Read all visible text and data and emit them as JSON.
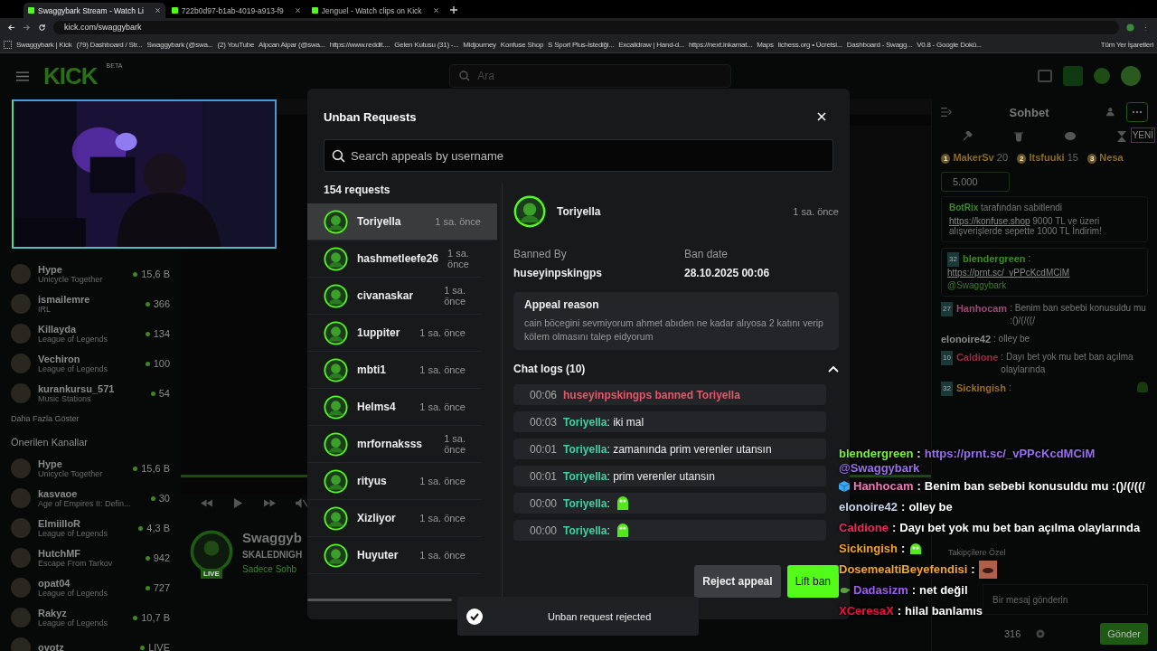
{
  "browser": {
    "tabs": [
      {
        "title": "Swaggybark Stream - Watch Li",
        "selected": true
      },
      {
        "title": "722b0d97-b1ab-4019-a913-f9",
        "selected": false
      },
      {
        "title": "Jenguel - Watch clips on Kick",
        "selected": false
      }
    ],
    "url": "kick.com/swaggybark",
    "bookmarks": [
      "Swaggybark | Kick",
      "(79) Dashboard / Str...",
      "Swaggybark (@swa...",
      "(2) YouTube",
      "Alpcan Alpar (@swa...",
      "https://www.reddit....",
      "Gelen Kutusu (31) -...",
      "Midjourney",
      "Konfuse Shop",
      "S Sport Plus-İstediği...",
      "Excalidraw | Hand-d...",
      "https://next.inkamat...",
      "Maps",
      "lichess.org • Ücretsi...",
      "Dashboard - Swagg...",
      "V0.8 - Google Dokü..."
    ],
    "all_bookmarks": "Tüm Yer İşaretleri"
  },
  "header": {
    "logo": "KICK",
    "logo_badge": "BETA",
    "search_placeholder": "Ara"
  },
  "sidebar": {
    "followed": [
      {
        "name": "Hype",
        "category": "Unicycle Together",
        "viewers": "15,6 B"
      },
      {
        "name": "ismailemre",
        "category": "IRL",
        "viewers": "366"
      },
      {
        "name": "Killayda",
        "category": "League of Legends",
        "viewers": "134"
      },
      {
        "name": "Vechiron",
        "category": "League of Legends",
        "viewers": "100"
      },
      {
        "name": "kurankursu_571",
        "category": "Music Stations",
        "viewers": "54"
      }
    ],
    "show_more": "Daha Fazla Göster",
    "recommended_heading": "Önerilen Kanallar",
    "recommended": [
      {
        "name": "Hype",
        "category": "Unicycle Together",
        "viewers": "15,6 B"
      },
      {
        "name": "kasvaoe",
        "category": "Age of Empires II: Defin...",
        "viewers": "30"
      },
      {
        "name": "ElmiilloR",
        "category": "League of Legends",
        "viewers": "4,3 B"
      },
      {
        "name": "HutchMF",
        "category": "Escape From Tarkov",
        "viewers": "942"
      },
      {
        "name": "opat04",
        "category": "League of Legends",
        "viewers": "727"
      },
      {
        "name": "Rakyz",
        "category": "League of Legends",
        "viewers": "10,7 B"
      },
      {
        "name": "ovotz",
        "viewers": "LIVE"
      }
    ]
  },
  "stream": {
    "live": "LIVE",
    "channel": "Swaggyb",
    "title": "SKALEDNIGH",
    "category": "Sadece Sohb"
  },
  "chat": {
    "title": "Sohbet",
    "new_badge": "YENİ",
    "leaderboard": [
      {
        "rank": "1",
        "name": "MakerSv",
        "score": "20"
      },
      {
        "rank": "2",
        "name": "Itsfuuki",
        "score": "15"
      },
      {
        "rank": "3",
        "name": "Nesa"
      }
    ],
    "gift": "5.000",
    "pinned": {
      "by": "BotRix",
      "note": "tarafından sabitlendi",
      "link": "https://konfuse.shop",
      "text": " 9000 TL ve üzeri alışverişlerde sepette 1000 TL İndirim!"
    },
    "messages": [
      {
        "badge": "32",
        "user": "blendergreen",
        "color": "#3a8a22",
        "text": ":",
        "link": "https://prnt.sc/_vPPcKcdMCiM",
        "mention": "@Swaggybark"
      },
      {
        "badge": "27",
        "user": "Hanhocam",
        "color": "#9a4a72",
        "text": ": Benim ban sebebi konusuldu mu :()/(/((/"
      },
      {
        "user": "elonoire42",
        "color": "#8a8a8a",
        "text": ": olley be"
      },
      {
        "badge": "10",
        "user": "Caldione",
        "color": "#9a2c40",
        "text": ": Dayı bet yok mu bet ban açılma olaylarında"
      },
      {
        "badge": "32",
        "user": "Sickingish",
        "color": "#9a6c20",
        "text": ":",
        "emote": true
      }
    ],
    "followers_only": "Takipçilere Özel",
    "input_placeholder": "Bir mesaj gönderin",
    "points": "316",
    "send": "Gönder"
  },
  "modal": {
    "title": "Unban Requests",
    "search_placeholder": "Search appeals by username",
    "count": "154 requests",
    "requests": [
      {
        "name": "Toriyella",
        "time": "1 sa. önce",
        "selected": true
      },
      {
        "name": "hashmetleefe26",
        "time": "1 sa. önce",
        "selected": false
      },
      {
        "name": "civanaskar",
        "time": "1 sa. önce",
        "selected": false
      },
      {
        "name": "1uppiter",
        "time": "1 sa. önce",
        "selected": false
      },
      {
        "name": "mbti1",
        "time": "1 sa. önce",
        "selected": false
      },
      {
        "name": "Helms4",
        "time": "1 sa. önce",
        "selected": false
      },
      {
        "name": "mrfornaksss",
        "time": "1 sa. önce",
        "selected": false
      },
      {
        "name": "rityus",
        "time": "1 sa. önce",
        "selected": false
      },
      {
        "name": "Xizliyor",
        "time": "1 sa. önce",
        "selected": false
      },
      {
        "name": "Huyuter",
        "time": "1 sa. önce",
        "selected": false
      }
    ],
    "detail": {
      "name": "Toriyella",
      "time": "1 sa. önce",
      "banned_by_label": "Banned By",
      "banned_by": "huseyinpskingps",
      "ban_date_label": "Ban date",
      "ban_date": "28.10.2025 00:06",
      "appeal_title": "Appeal reason",
      "appeal_text": "cain böcegini sevmiyorum ahmet abıden ne kadar alıyosa 2 katını verip kölem olmasını talep eidyorum",
      "logs_title": "Chat logs (10)",
      "logs_expanded": true,
      "logs": [
        {
          "kind": "ban",
          "time": "00:06",
          "text": "huseyinpskingps banned Toriyella"
        },
        {
          "kind": "message",
          "time": "00:03",
          "user": "Toriyella",
          "text": ": iki mal"
        },
        {
          "kind": "message",
          "time": "00:01",
          "user": "Toriyella",
          "text": ": zamanında prim verenler utansın"
        },
        {
          "kind": "message",
          "time": "00:01",
          "user": "Toriyella",
          "text": ": prim verenler utansın"
        },
        {
          "kind": "emote",
          "time": "00:00",
          "user": "Toriyella",
          "text": ":"
        },
        {
          "kind": "emote",
          "time": "00:00",
          "user": "Toriyella",
          "text": ":"
        }
      ]
    },
    "reject": "Reject appeal",
    "lift": "Lift ban"
  },
  "toast": "Unban request rejected",
  "overlay_chat": [
    {
      "user": "blendergreen",
      "color": "#7cf03c",
      "kind": "link",
      "sep": ":",
      "text": "https://prnt.sc/_vPPcKcdMCiM",
      "mention": "@Swaggybark"
    },
    {
      "user": "Hanhocam",
      "color": "#f07ab8",
      "badge": true,
      "kind": "text",
      "sep": ":",
      "text": "Benim ban sebebi konusuldu mu :()/(/((/"
    },
    {
      "user": "elonoire42",
      "color": "#c8d4ec",
      "kind": "text",
      "sep": ":",
      "text": "olley be"
    },
    {
      "user": "Caldione",
      "color": "#f0285a",
      "kind": "text",
      "sep": ":",
      "text": "Dayı bet yok mu bet ban açılma olaylarında"
    },
    {
      "user": "Sickingish",
      "color": "#f0a428",
      "kind": "emote",
      "sep": ":"
    },
    {
      "user": "DosemealtiBeyefendisi",
      "color": "#f0a830",
      "kind": "sticker",
      "sep": ":"
    },
    {
      "user": "Dadasizm",
      "color": "#a25cf0",
      "badge": true,
      "kind": "text",
      "sep": ":",
      "text": "net değil"
    },
    {
      "user": "XCeresaX",
      "color": "#f0103c",
      "kind": "text",
      "sep": ":",
      "text": "hilal banlamıs"
    }
  ]
}
